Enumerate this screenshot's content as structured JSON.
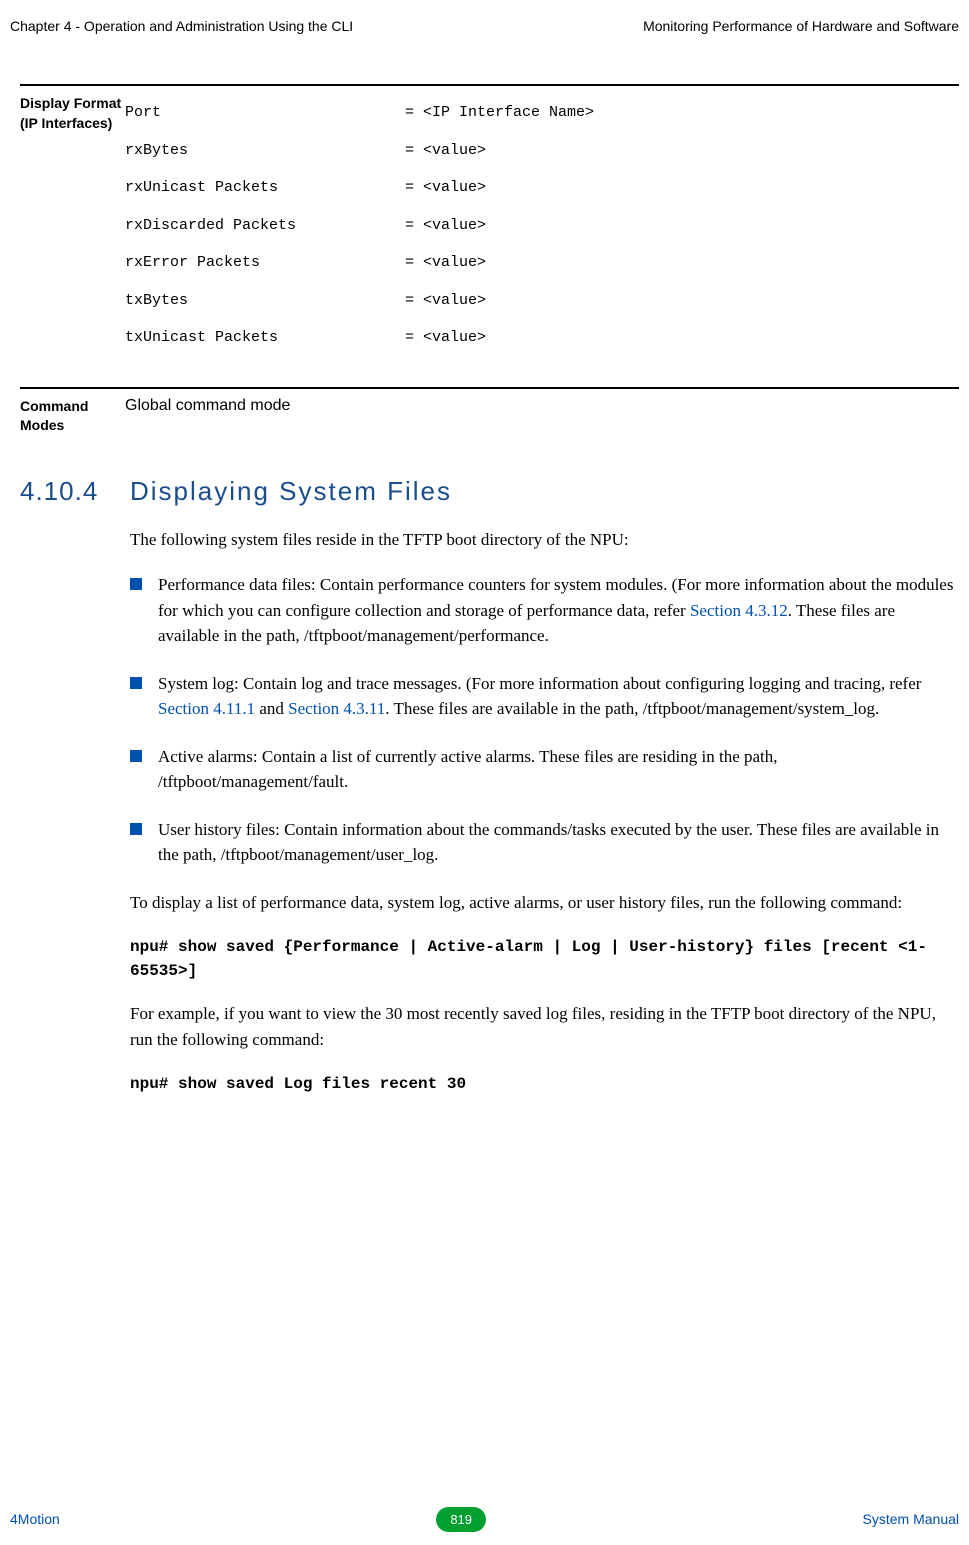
{
  "header": {
    "left": "Chapter 4 - Operation and Administration Using the CLI",
    "right": "Monitoring Performance of Hardware and Software"
  },
  "display_format": {
    "label": "Display Format (IP Interfaces)",
    "rows": [
      {
        "key": "Port",
        "val": "= <IP Interface Name>"
      },
      {
        "key": "rxBytes",
        "val": "= <value>"
      },
      {
        "key": "rxUnicast Packets",
        "val": "= <value>"
      },
      {
        "key": "rxDiscarded Packets",
        "val": "= <value>"
      },
      {
        "key": "rxError Packets",
        "val": "= <value>"
      },
      {
        "key": "txBytes",
        "val": "= <value>"
      },
      {
        "key": "txUnicast Packets",
        "val": "= <value>"
      }
    ]
  },
  "command_modes": {
    "label": "Command Modes",
    "value": "Global command mode"
  },
  "section": {
    "number": "4.10.4",
    "title": "Displaying System Files"
  },
  "intro": "The following system files reside in the TFTP boot directory of the NPU:",
  "bullets": [
    {
      "pre": "Performance data files: Contain performance counters for system modules. (For more information about the modules for which you can configure collection and storage of performance data, refer ",
      "link1": "Section 4.3.12",
      "post1": ". These files are available in the path, /tftpboot/management/performance."
    },
    {
      "pre": "System log: Contain log and trace messages. (For more information about configuring logging and tracing, refer ",
      "link1": "Section 4.11.1",
      "mid": " and ",
      "link2": "Section 4.3.11",
      "post1": ". These files are available in the path, /tftpboot/management/system_log."
    },
    {
      "pre": "Active alarms: Contain a list of currently active alarms. These files are residing in the path, /tftpboot/management/fault."
    },
    {
      "pre": "User history files: Contain information about the commands/tasks executed by the user. These files are available in the path, /tftpboot/management/user_log."
    }
  ],
  "run_command_intro": "To display a list of performance data, system log, active alarms, or user history files, run the following command:",
  "command1": "npu# show saved {Performance | Active-alarm | Log | User-history} files [recent <1-65535>]",
  "example_intro": "For example, if you want to view the 30 most recently saved log files, residing in the TFTP boot directory of the NPU, run the following command:",
  "command2": "npu# show saved Log files recent 30",
  "footer": {
    "left": "4Motion",
    "page": "819",
    "right": "System Manual"
  }
}
